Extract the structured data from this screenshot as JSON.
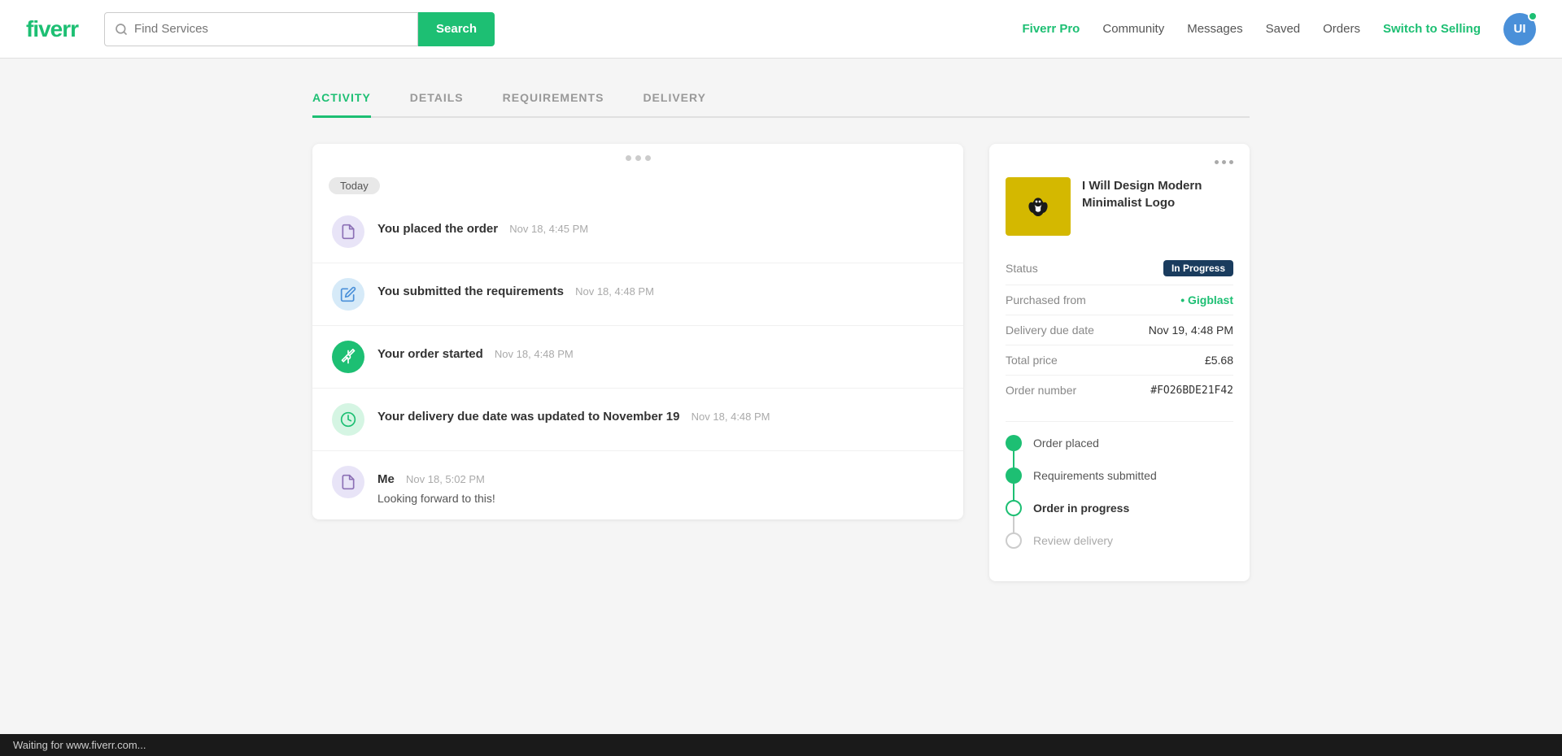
{
  "header": {
    "logo": "fiverr",
    "search": {
      "placeholder": "Find Services",
      "button_label": "Search"
    },
    "nav": {
      "fiverr_pro": "Fiverr Pro",
      "community": "Community",
      "messages": "Messages",
      "saved": "Saved",
      "orders": "Orders",
      "switch_to_selling": "Switch to Selling",
      "avatar_initials": "UI"
    }
  },
  "tabs": [
    {
      "id": "activity",
      "label": "ACTIVITY",
      "active": true
    },
    {
      "id": "details",
      "label": "DETAILS",
      "active": false
    },
    {
      "id": "requirements",
      "label": "REQUIREMENTS",
      "active": false
    },
    {
      "id": "delivery",
      "label": "DELIVERY",
      "active": false
    }
  ],
  "activity": {
    "today_label": "Today",
    "items": [
      {
        "icon": "document",
        "icon_style": "purple",
        "title": "You placed the order",
        "time": "Nov 18, 4:45 PM",
        "message": null
      },
      {
        "icon": "pencil",
        "icon_style": "blue",
        "title": "You submitted the requirements",
        "time": "Nov 18, 4:48 PM",
        "message": null
      },
      {
        "icon": "rocket",
        "icon_style": "green",
        "title": "Your order started",
        "time": "Nov 18, 4:48 PM",
        "message": null
      },
      {
        "icon": "clock",
        "icon_style": "green-light",
        "title": "Your delivery due date was updated to November 19",
        "time": "Nov 18, 4:48 PM",
        "message": null
      },
      {
        "icon": "document",
        "icon_style": "purple",
        "title": "Me",
        "time": "Nov 18, 5:02 PM",
        "message": "Looking forward to this!"
      }
    ]
  },
  "order": {
    "gig_title": "I Will Design Modern Minimalist Logo",
    "status_label": "Status",
    "status_value": "In Progress",
    "purchased_from_label": "Purchased from",
    "seller_name": "Gigblast",
    "delivery_due_label": "Delivery due date",
    "delivery_due_value": "Nov 19, 4:48 PM",
    "total_price_label": "Total price",
    "total_price_value": "£5.68",
    "order_number_label": "Order number",
    "order_number_value": "#FO26BDE21F42",
    "timeline": [
      {
        "label": "Order placed",
        "state": "filled"
      },
      {
        "label": "Requirements submitted",
        "state": "filled"
      },
      {
        "label": "Order in progress",
        "state": "outline"
      },
      {
        "label": "Review delivery",
        "state": "gray"
      }
    ]
  },
  "status_bar": {
    "text": "Waiting for www.fiverr.com..."
  }
}
